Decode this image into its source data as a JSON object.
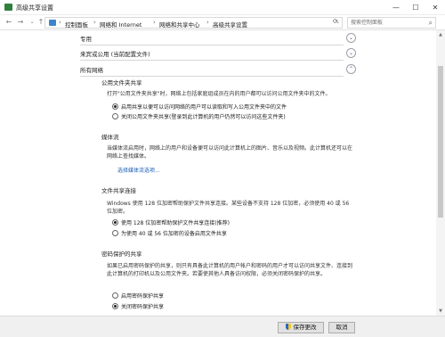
{
  "window": {
    "title": "高级共享设置",
    "minimize": "—",
    "maximize": "☐",
    "close": "✕"
  },
  "nav": {
    "back": "←",
    "forward": "→",
    "up": "↑",
    "dropdown": "⌄"
  },
  "breadcrumbs": [
    "控制面板",
    "网络和 Internet",
    "网络和共享中心",
    "高级共享设置"
  ],
  "search": {
    "placeholder": "搜索控制面板"
  },
  "profiles": [
    {
      "label": "专用",
      "expanded": false
    },
    {
      "label": "来宾或公用 (当前配置文件)",
      "expanded": false
    },
    {
      "label": "所有网络",
      "expanded": true
    }
  ],
  "sections": {
    "public_folder": {
      "title": "公用文件夹共享",
      "desc": "打开\"公用文件夹共享\"时，网络上包括家庭组成员在内的用户都可以访问公用文件夹中的文件。",
      "options": [
        {
          "label": "启用共享以便可以访问网络的用户可以读取和写入公用文件夹中的文件",
          "checked": true
        },
        {
          "label": "关闭公用文件夹共享(登录到此计算机的用户仍然可以访问这些文件夹)",
          "checked": false
        }
      ]
    },
    "media": {
      "title": "媒体流",
      "desc": "当媒体流启用时，网络上的用户和设备便可以访问此计算机上的图片、音乐以及视频。此计算机还可以在网络上查找媒体。",
      "link": "选择媒体流选项..."
    },
    "file_sharing": {
      "title": "文件共享连接",
      "desc": "Windows 使用 128 位加密帮助保护文件共享连接。某些设备不支持 128 位加密，必须使用 40 或 56 位加密。",
      "options": [
        {
          "label": "使用 128 位加密帮助保护文件共享连接(推荐)",
          "checked": true
        },
        {
          "label": "为使用 40 或 56 位加密的设备启用文件共享",
          "checked": false
        }
      ]
    },
    "password": {
      "title": "密码保护的共享",
      "desc": "如果已启用密码保护的共享，则只有具备此计算机的用户帐户和密码的用户才可以访问共享文件、连接到此计算机的打印机以及公用文件夹。若要使其他人具备访问权限，必须关闭密码保护的共享。",
      "options": [
        {
          "label": "启用密码保护共享",
          "checked": false
        },
        {
          "label": "关闭密码保护共享",
          "checked": true
        }
      ]
    }
  },
  "buttons": {
    "save": "保存更改",
    "cancel": "取消"
  }
}
